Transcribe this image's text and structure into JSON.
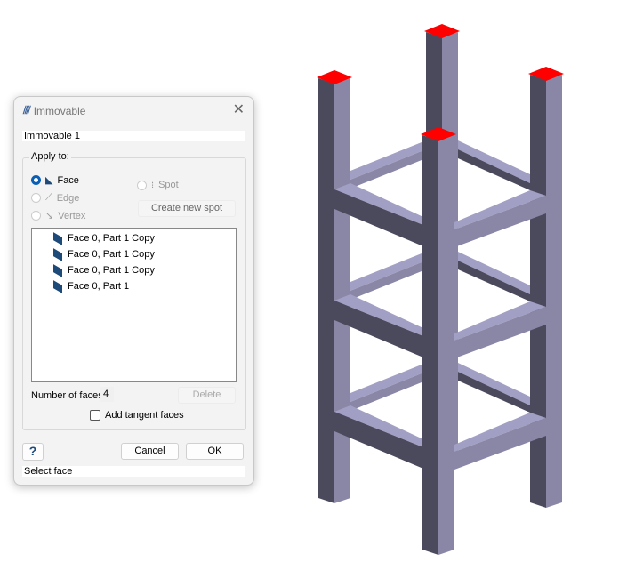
{
  "dialog": {
    "title": "Immovable",
    "name_value": "Immovable 1",
    "apply_to_label": "Apply to:",
    "options": [
      {
        "label": "Face",
        "selected": true,
        "enabled": true
      },
      {
        "label": "Edge",
        "selected": false,
        "enabled": false
      },
      {
        "label": "Vertex",
        "selected": false,
        "enabled": false
      },
      {
        "label": "Spot",
        "selected": false,
        "enabled": false
      }
    ],
    "create_spot_label": "Create new spot",
    "faces": [
      "Face 0, Part 1 Copy",
      "Face 0, Part 1 Copy",
      "Face 0, Part 1 Copy",
      "Face 0, Part 1"
    ],
    "num_faces_label": "Number of faces",
    "num_faces_value": "4",
    "delete_label": "Delete",
    "tangent_label": "Add tangent faces",
    "help_label": "?",
    "cancel_label": "Cancel",
    "ok_label": "OK",
    "status": "Select face"
  },
  "colors": {
    "accent": "#0a5fb4",
    "selected_face": "#ff0000",
    "part_dark": "#4b4a5d",
    "part_light": "#a29fc4",
    "part_mid": "#8986a6"
  }
}
